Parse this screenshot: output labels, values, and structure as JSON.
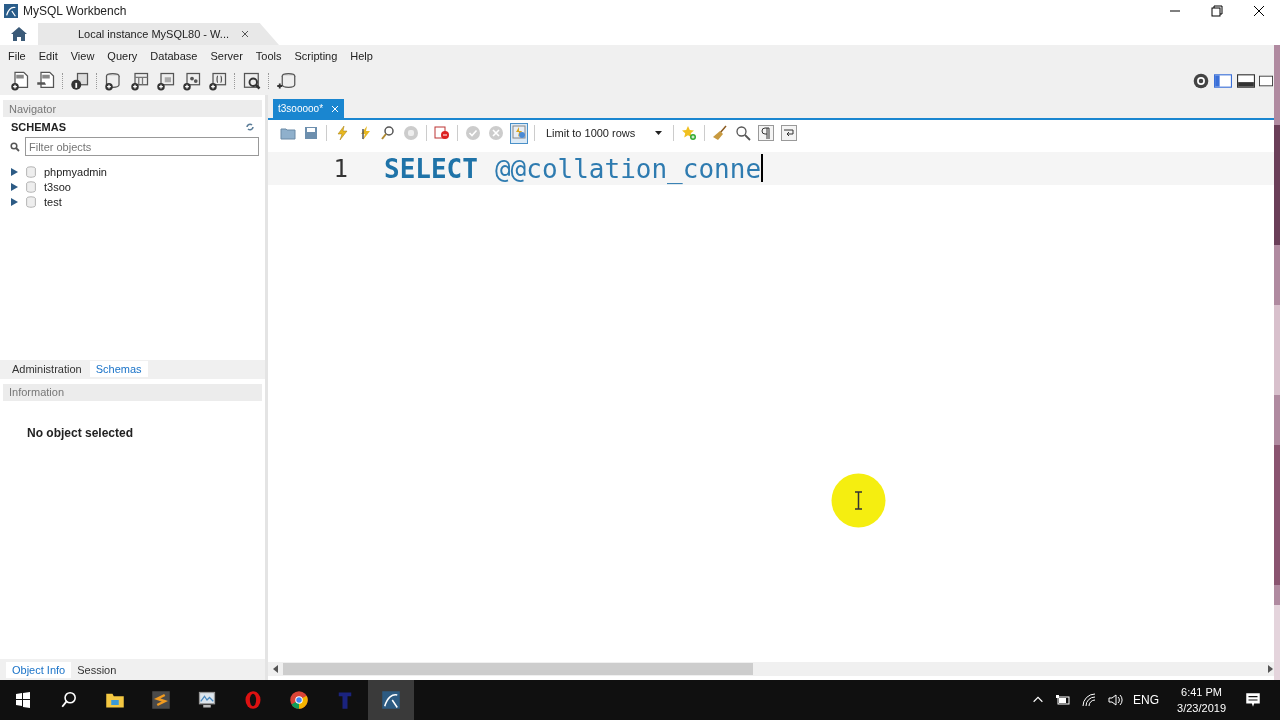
{
  "window": {
    "title": "MySQL Workbench"
  },
  "connection_tabs": [
    {
      "label": "Local instance MySQL80 - W...",
      "selected": true
    }
  ],
  "menu": [
    "File",
    "Edit",
    "View",
    "Query",
    "Database",
    "Server",
    "Tools",
    "Scripting",
    "Help"
  ],
  "navigator": {
    "header": "Navigator",
    "section": "SCHEMAS",
    "filter_placeholder": "Filter objects",
    "schemas": [
      {
        "name": "phpmyadmin",
        "expanded": false
      },
      {
        "name": "t3soo",
        "expanded": false
      },
      {
        "name": "test",
        "expanded": false
      }
    ]
  },
  "nav_tabs": [
    {
      "label": "Administration",
      "selected": false
    },
    {
      "label": "Schemas",
      "selected": true
    }
  ],
  "information": {
    "header": "Information",
    "message": "No object selected"
  },
  "bottom_tabs": [
    {
      "label": "Object Info",
      "selected": true
    },
    {
      "label": "Session",
      "selected": false
    }
  ],
  "editor": {
    "tab": {
      "label": "t3sooooo*"
    },
    "limit": "Limit to 1000 rows",
    "lines": [
      {
        "number": "1",
        "tokens": [
          {
            "kind": "keyword",
            "text": "SELECT"
          },
          {
            "kind": "variable",
            "text": "@@collation_conne"
          }
        ]
      }
    ]
  },
  "taskbar": {
    "language": "ENG",
    "time": "6:41 PM",
    "date": "3/23/2019"
  }
}
